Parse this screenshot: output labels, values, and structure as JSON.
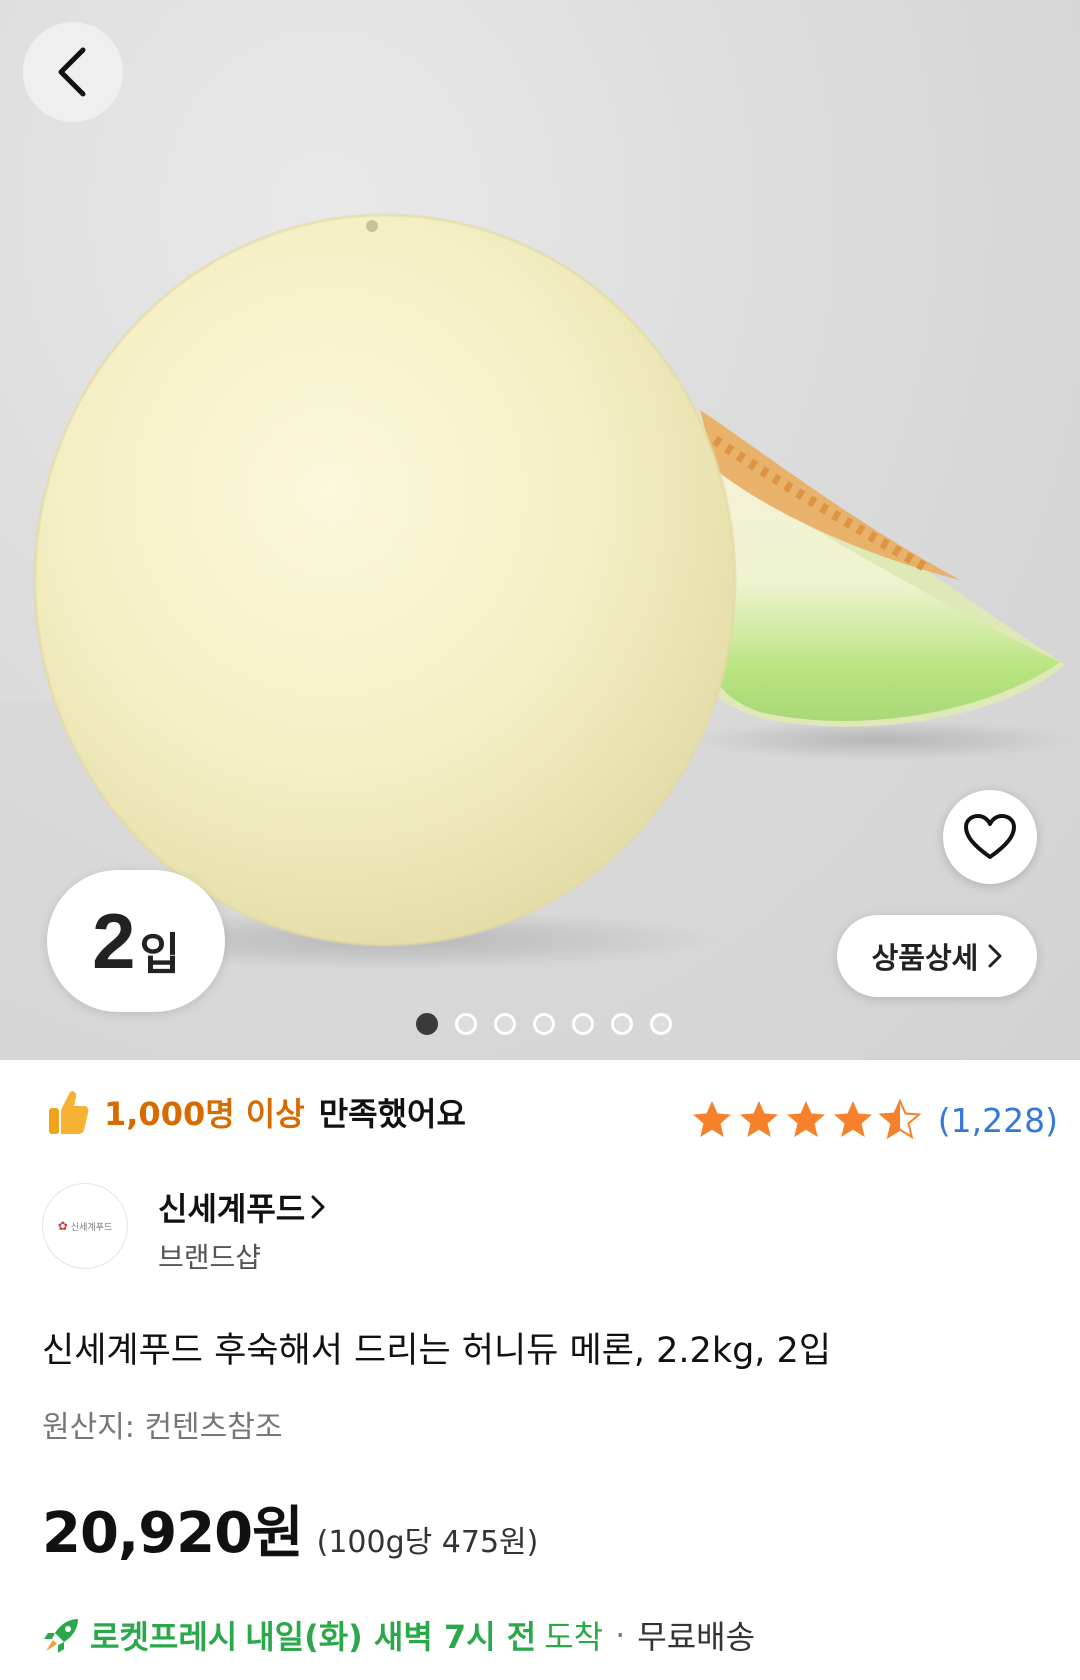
{
  "hero": {
    "badge_number": "2",
    "badge_unit": "입",
    "detail_button_label": "상품상세",
    "carousel": {
      "total": 7,
      "active_index": 0
    }
  },
  "satisfaction": {
    "highlight": "1,000명 이상",
    "text": "만족했어요"
  },
  "rating": {
    "stars": 4.5,
    "review_count": "(1,228)"
  },
  "brand": {
    "name": "신세계푸드",
    "subtitle": "브랜드샵",
    "logo_text": "신세계푸드"
  },
  "product": {
    "title": "신세계푸드 후숙해서 드리는 허니듀 메론, 2.2kg, 2입",
    "origin": "원산지: 컨텐츠참조",
    "price": "20,920원",
    "unit_price": "(100g당 475원)"
  },
  "delivery": {
    "service": "로켓프레시",
    "date": "내일(화) 새벽 7시 전",
    "arrive": "도착",
    "separator": "·",
    "shipping": "무료배송"
  },
  "colors": {
    "accent_orange": "#d86a00",
    "star": "#f5822a",
    "link_blue": "#3478d8",
    "rocket_green": "#2aa84a"
  }
}
